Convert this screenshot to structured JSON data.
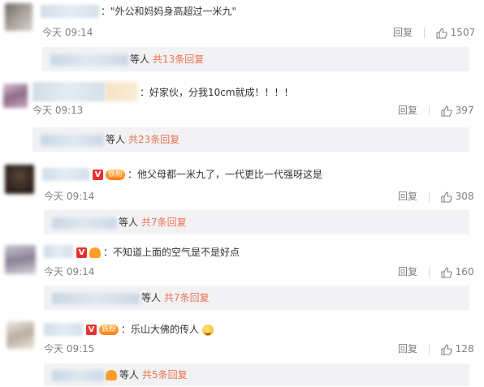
{
  "comments": [
    {
      "text": "：\"外公和妈妈身高超过一米九\"",
      "time": "今天 09:14",
      "reply_label": "回复",
      "likes": "1507",
      "thread_suffix": "等人",
      "thread_count": "共13条回复",
      "badges": []
    },
    {
      "text": "：好家伙，分我10cm就成！！！！",
      "time": "今天 09:13",
      "reply_label": "回复",
      "likes": "397",
      "thread_suffix": "等人",
      "thread_count": "共23条回复",
      "badges": []
    },
    {
      "text": "：他父母都一米九了，一代更比一代强呀这是",
      "time": "今天 09:14",
      "reply_label": "回复",
      "likes": "308",
      "thread_suffix": "等人",
      "thread_count": "共7条回复",
      "badges": [
        "V",
        "fan"
      ]
    },
    {
      "text": "：不知道上面的空气是不是好点",
      "time": "今天 09:14",
      "reply_label": "回复",
      "likes": "160",
      "thread_suffix": "等人",
      "thread_count": "共7条回复",
      "badges": [
        "V",
        "crown"
      ]
    },
    {
      "text": "：乐山大佛的传人",
      "time": "今天 09:15",
      "reply_label": "回复",
      "likes": "128",
      "thread_suffix": "等人",
      "thread_count": "共5条回复",
      "badges": [
        "V",
        "fan"
      ]
    }
  ],
  "badge_labels": {
    "v": "V",
    "fan": "铁粉"
  },
  "colors": {
    "accent": "#eb7350",
    "muted": "#808080",
    "reply_bg": "#f2f2f5",
    "v_badge": "#e8312f"
  },
  "icons": {
    "like": "thumbs-up-icon",
    "emoji": "laughing-tears-emoji-icon"
  }
}
